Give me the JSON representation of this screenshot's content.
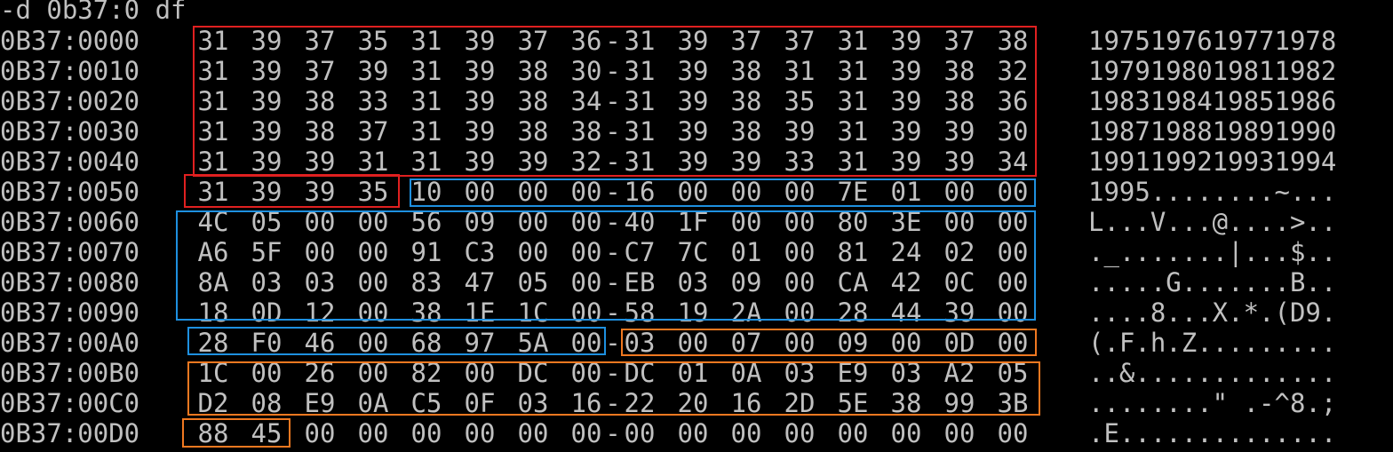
{
  "command": "-d 0b37:0 df",
  "rows": [
    {
      "addr": "0B37:0000",
      "bytes": [
        "31",
        "39",
        "37",
        "35",
        "31",
        "39",
        "37",
        "36",
        "31",
        "39",
        "37",
        "37",
        "31",
        "39",
        "37",
        "38"
      ],
      "sep": "-",
      "ascii": "1975197619771978"
    },
    {
      "addr": "0B37:0010",
      "bytes": [
        "31",
        "39",
        "37",
        "39",
        "31",
        "39",
        "38",
        "30",
        "31",
        "39",
        "38",
        "31",
        "31",
        "39",
        "38",
        "32"
      ],
      "sep": "-",
      "ascii": "1979198019811982"
    },
    {
      "addr": "0B37:0020",
      "bytes": [
        "31",
        "39",
        "38",
        "33",
        "31",
        "39",
        "38",
        "34",
        "31",
        "39",
        "38",
        "35",
        "31",
        "39",
        "38",
        "36"
      ],
      "sep": "-",
      "ascii": "1983198419851986"
    },
    {
      "addr": "0B37:0030",
      "bytes": [
        "31",
        "39",
        "38",
        "37",
        "31",
        "39",
        "38",
        "38",
        "31",
        "39",
        "38",
        "39",
        "31",
        "39",
        "39",
        "30"
      ],
      "sep": "-",
      "ascii": "1987198819891990"
    },
    {
      "addr": "0B37:0040",
      "bytes": [
        "31",
        "39",
        "39",
        "31",
        "31",
        "39",
        "39",
        "32",
        "31",
        "39",
        "39",
        "33",
        "31",
        "39",
        "39",
        "34"
      ],
      "sep": "-",
      "ascii": "1991199219931994"
    },
    {
      "addr": "0B37:0050",
      "bytes": [
        "31",
        "39",
        "39",
        "35",
        "10",
        "00",
        "00",
        "00",
        "16",
        "00",
        "00",
        "00",
        "7E",
        "01",
        "00",
        "00"
      ],
      "sep": "-",
      "ascii": "1995........~..."
    },
    {
      "addr": "0B37:0060",
      "bytes": [
        "4C",
        "05",
        "00",
        "00",
        "56",
        "09",
        "00",
        "00",
        "40",
        "1F",
        "00",
        "00",
        "80",
        "3E",
        "00",
        "00"
      ],
      "sep": "-",
      "ascii": "L...V...@....>.."
    },
    {
      "addr": "0B37:0070",
      "bytes": [
        "A6",
        "5F",
        "00",
        "00",
        "91",
        "C3",
        "00",
        "00",
        "C7",
        "7C",
        "01",
        "00",
        "81",
        "24",
        "02",
        "00"
      ],
      "sep": "-",
      "ascii": "._.......|...$.."
    },
    {
      "addr": "0B37:0080",
      "bytes": [
        "8A",
        "03",
        "03",
        "00",
        "83",
        "47",
        "05",
        "00",
        "EB",
        "03",
        "09",
        "00",
        "CA",
        "42",
        "0C",
        "00"
      ],
      "sep": "-",
      "ascii": ".....G.......B.."
    },
    {
      "addr": "0B37:0090",
      "bytes": [
        "18",
        "0D",
        "12",
        "00",
        "38",
        "1E",
        "1C",
        "00",
        "58",
        "19",
        "2A",
        "00",
        "28",
        "44",
        "39",
        "00"
      ],
      "sep": "-",
      "ascii": "....8...X.*.(D9."
    },
    {
      "addr": "0B37:00A0",
      "bytes": [
        "28",
        "F0",
        "46",
        "00",
        "68",
        "97",
        "5A",
        "00",
        "03",
        "00",
        "07",
        "00",
        "09",
        "00",
        "0D",
        "00"
      ],
      "sep": "-",
      "ascii": "(.F.h.Z........."
    },
    {
      "addr": "0B37:00B0",
      "bytes": [
        "1C",
        "00",
        "26",
        "00",
        "82",
        "00",
        "DC",
        "00",
        "DC",
        "01",
        "0A",
        "03",
        "E9",
        "03",
        "A2",
        "05"
      ],
      "sep": "-",
      "ascii": "..&............."
    },
    {
      "addr": "0B37:00C0",
      "bytes": [
        "D2",
        "08",
        "E9",
        "0A",
        "C5",
        "0F",
        "03",
        "16",
        "22",
        "20",
        "16",
        "2D",
        "5E",
        "38",
        "99",
        "3B"
      ],
      "sep": "-",
      "ascii": "........\" .-^8.;"
    },
    {
      "addr": "0B37:00D0",
      "bytes": [
        "88",
        "45",
        "00",
        "00",
        "00",
        "00",
        "00",
        "00",
        "00",
        "00",
        "00",
        "00",
        "00",
        "00",
        "00",
        "00"
      ],
      "sep": "-",
      "ascii": ".E.............."
    }
  ],
  "colors": {
    "background": "#000000",
    "text": "#c0c0c0",
    "highlight_red": "#e02020",
    "highlight_blue": "#1e90e0",
    "highlight_orange": "#f07820"
  }
}
